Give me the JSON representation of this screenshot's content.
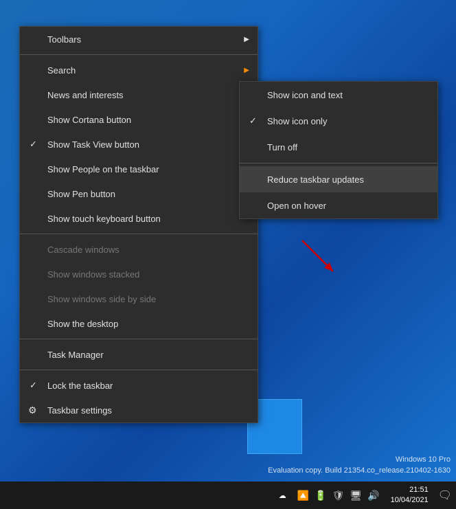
{
  "desktop": {
    "background": "blue gradient"
  },
  "contextMenu": {
    "items": [
      {
        "id": "toolbars",
        "label": "Toolbars",
        "type": "arrow",
        "disabled": false
      },
      {
        "id": "search",
        "label": "Search",
        "type": "arrow-orange",
        "disabled": false
      },
      {
        "id": "news",
        "label": "News and interests",
        "type": "arrow",
        "disabled": false
      },
      {
        "id": "cortana",
        "label": "Show Cortana button",
        "type": "normal",
        "disabled": false
      },
      {
        "id": "taskview",
        "label": "Show Task View button",
        "type": "check",
        "disabled": false
      },
      {
        "id": "people",
        "label": "Show People on the taskbar",
        "type": "normal",
        "disabled": false
      },
      {
        "id": "pen",
        "label": "Show Pen button",
        "type": "normal",
        "disabled": false
      },
      {
        "id": "keyboard",
        "label": "Show touch keyboard button",
        "type": "normal",
        "disabled": false
      },
      {
        "id": "sep1",
        "type": "separator"
      },
      {
        "id": "cascade",
        "label": "Cascade windows",
        "type": "normal",
        "disabled": true
      },
      {
        "id": "stacked",
        "label": "Show windows stacked",
        "type": "normal",
        "disabled": true
      },
      {
        "id": "sidebyside",
        "label": "Show windows side by side",
        "type": "normal",
        "disabled": true
      },
      {
        "id": "desktop",
        "label": "Show the desktop",
        "type": "normal",
        "disabled": false
      },
      {
        "id": "sep2",
        "type": "separator"
      },
      {
        "id": "taskmanager",
        "label": "Task Manager",
        "type": "normal",
        "disabled": false
      },
      {
        "id": "sep3",
        "type": "separator"
      },
      {
        "id": "lock",
        "label": "Lock the taskbar",
        "type": "check",
        "disabled": false
      },
      {
        "id": "settings",
        "label": "Taskbar settings",
        "type": "gear",
        "disabled": false
      }
    ]
  },
  "submenu": {
    "items": [
      {
        "id": "showIconText",
        "label": "Show icon and text",
        "type": "normal"
      },
      {
        "id": "showIconOnly",
        "label": "Show icon only",
        "type": "check"
      },
      {
        "id": "turnOff",
        "label": "Turn off",
        "type": "normal"
      },
      {
        "id": "sep1",
        "type": "separator"
      },
      {
        "id": "reduceUpdates",
        "label": "Reduce taskbar updates",
        "type": "highlighted"
      },
      {
        "id": "openHover",
        "label": "Open on hover",
        "type": "normal"
      }
    ]
  },
  "taskbar": {
    "weatherIcon": "☁",
    "icons": [
      "🔼",
      "🔋",
      "🛡",
      "🖥",
      "🔊"
    ],
    "clock": {
      "time": "21:51",
      "date": "10/04/2021"
    },
    "notificationIcon": "🗨"
  },
  "watermark": {
    "line1": "Windows 10 Pro",
    "line2": "Evaluation copy. Build 21354.co_release.210402-1630"
  }
}
